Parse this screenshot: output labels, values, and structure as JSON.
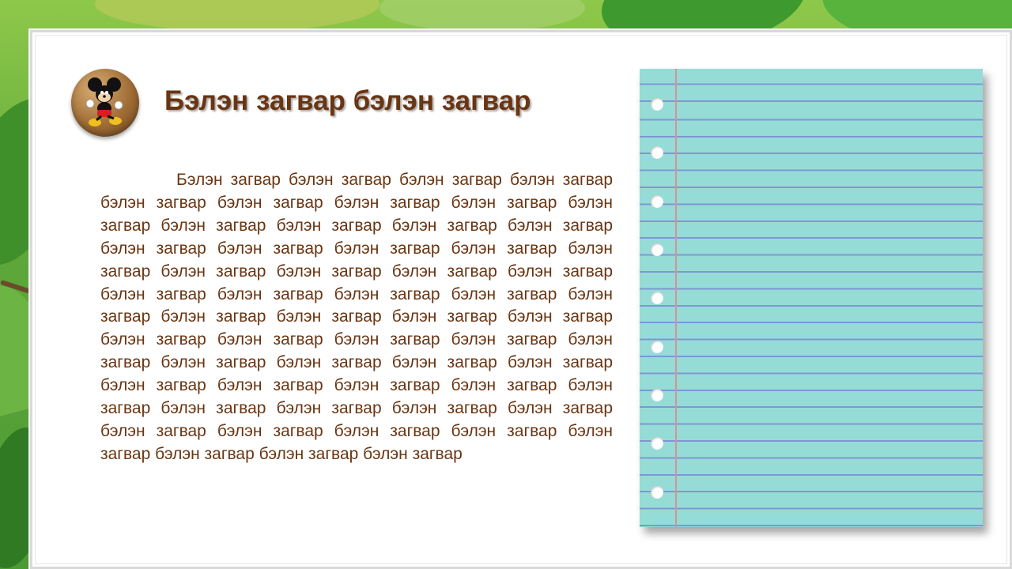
{
  "slide": {
    "title": "Бэлэн загвар бэлэн загвар",
    "body": "Бэлэн загвар бэлэн загвар бэлэн загвар бэлэн загвар бэлэн загвар бэлэн загвар бэлэн загвар бэлэн загвар бэлэн загвар бэлэн загвар бэлэн загвар бэлэн загвар бэлэн загвар бэлэн загвар бэлэн загвар бэлэн загвар бэлэн загвар бэлэн загвар бэлэн загвар бэлэн загвар бэлэн загвар бэлэн загвар бэлэн загвар бэлэн загвар бэлэн загвар бэлэн загвар бэлэн загвар бэлэн загвар бэлэн загвар бэлэн загвар бэлэн загвар бэлэн загвар бэлэн загвар бэлэн загвар бэлэн загвар бэлэн загвар бэлэн загвар бэлэн загвар бэлэн загвар бэлэн загвар бэлэн загвар бэлэн загвар бэлэн загвар бэлэн загвар бэлэн загвар бэлэн загвар бэлэн загвар бэлэн загвар бэлэн загвар бэлэн загвар бэлэн загвар бэлэн загвар бэлэн загвар бэлэн загвар бэлэн загвар бэлэн загвар бэлэн загвар"
  },
  "icons": {
    "logo": "mickey-mouse-icon"
  },
  "colors": {
    "title": "#6a3512",
    "body_text": "#6a3512",
    "notebook_paper": "#96dcd6",
    "notebook_rule": "#7e97d4",
    "notebook_margin": "#d9909a",
    "background_green": "#5fa83a"
  }
}
